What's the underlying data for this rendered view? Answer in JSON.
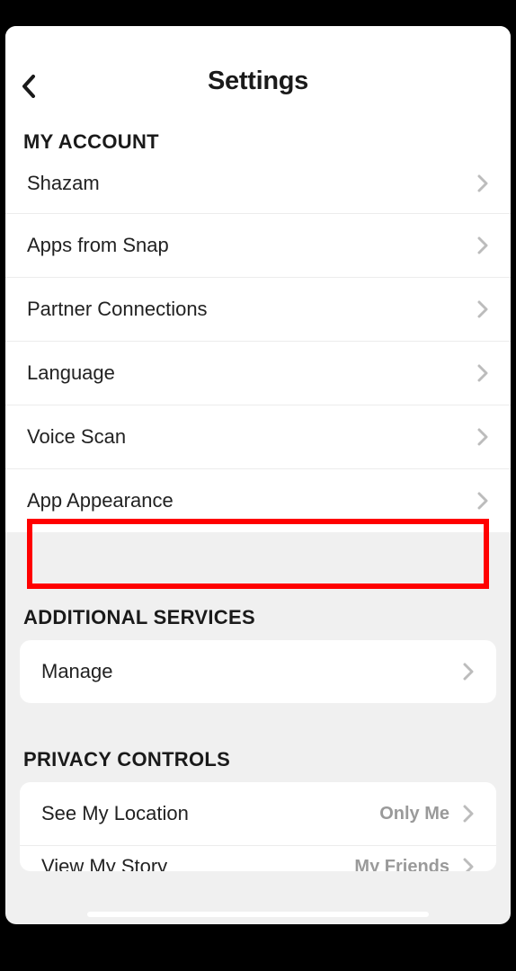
{
  "header": {
    "title": "Settings"
  },
  "sections": {
    "myAccount": {
      "title": "MY ACCOUNT",
      "items": [
        {
          "label": "Shazam"
        },
        {
          "label": "Apps from Snap"
        },
        {
          "label": "Partner Connections"
        },
        {
          "label": "Language"
        },
        {
          "label": "Voice Scan"
        },
        {
          "label": "App Appearance"
        }
      ]
    },
    "additionalServices": {
      "title": "ADDITIONAL SERVICES",
      "items": [
        {
          "label": "Manage"
        }
      ]
    },
    "privacyControls": {
      "title": "PRIVACY CONTROLS",
      "items": [
        {
          "label": "See My Location",
          "value": "Only Me"
        },
        {
          "label": "View My Story",
          "value": "My Friends"
        }
      ]
    }
  }
}
